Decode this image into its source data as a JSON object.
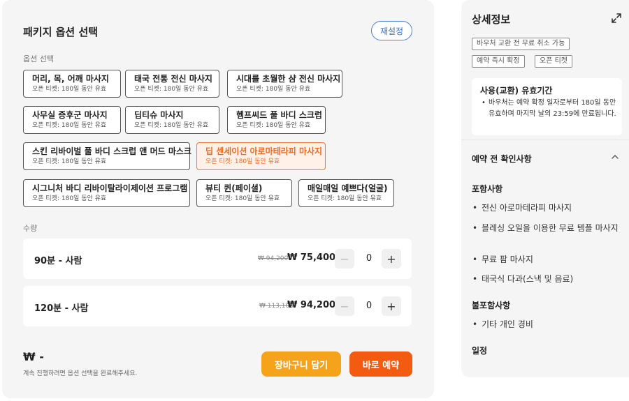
{
  "left": {
    "title": "패키지 옵션 선택",
    "reset_label": "재설정",
    "options_label": "옵션 선택",
    "options": [
      {
        "name": "머리, 목, 어깨 마사지",
        "sub": "오픈 티켓: 180일 동안 유효"
      },
      {
        "name": "태국 전통 전신 마사지",
        "sub": "오픈 티켓: 180일 동안 유효"
      },
      {
        "name": "시대를 초월한 샴 전신 마사지",
        "sub": "오픈 티켓: 180일 동안 유효"
      },
      {
        "name": "사무실 증후군 마사지",
        "sub": "오픈 티켓: 180일 동안 유효"
      },
      {
        "name": "딥티슈 마사지",
        "sub": "오픈 티켓: 180일 동안 유효"
      },
      {
        "name": "헴프씨드 풀 바디 스크럽",
        "sub": "오픈 티켓: 180일 동안 유효"
      },
      {
        "name": "스킨 리바이벌 풀 바디 스크럽 앤 머드 마스크",
        "sub": "오픈 티켓: 180일 동안 유효"
      },
      {
        "name": "딥 센세이션 아로마테라피 마사지",
        "sub": "오픈 티켓: 180일 동안 유효"
      },
      {
        "name": "시그니처 바디 리바이탈라이제이션 프로그램",
        "sub": "오픈 티켓: 180일 동안 유효"
      },
      {
        "name": "뷰티 퀸(페이셜)",
        "sub": "오픈 티켓: 180일 동안 유효"
      },
      {
        "name": "매일매일 예쁘다(얼굴)",
        "sub": "오픈 티켓: 180일 동안 유효"
      }
    ],
    "selected_option_index": 7,
    "quantity_label": "수량",
    "quantity_rows": [
      {
        "label": "90분 - 사람",
        "orig_price": "₩ 94,200",
        "price": "₩ 75,400",
        "count": "0",
        "minus": "−",
        "plus": "+"
      },
      {
        "label": "120분 - 사람",
        "orig_price": "₩ 113,100",
        "price": "₩ 94,200",
        "count": "0",
        "minus": "−",
        "plus": "+"
      }
    ],
    "total": "₩ -",
    "hint": "계속 진행하려면 옵션 선택을 완료해주세요.",
    "cart_label": "장바구니 담기",
    "book_label": "바로 예약"
  },
  "right": {
    "title": "상세정보",
    "tags": [
      "바우처 교환 전 무료 취소 가능",
      "예약 즉시 확정",
      "오픈 티켓"
    ],
    "validity_title": "사용(교환) 유효기간",
    "validity_body": "바우처는 예약 확정 일자로부터 180일 동안 유효하며 마지막 날의 23:59에 만료됩니다.",
    "notice_title": "예약 전 확인사항",
    "included_title": "포함사항",
    "included": [
      "전신 아로마테라피 마사지",
      "블레싱 오일을 이용한 무료 템플 마사지",
      "무료 팜 마사지",
      "태국식 다과(스낵 및 음료)"
    ],
    "excluded_title": "불포함사항",
    "excluded": [
      "기타 개인 경비"
    ],
    "schedule_title": "일정"
  },
  "colors": {
    "accent_orange": "#f35b11",
    "cart_orange": "#f5a31b",
    "reset_blue": "#3b6fc6"
  }
}
